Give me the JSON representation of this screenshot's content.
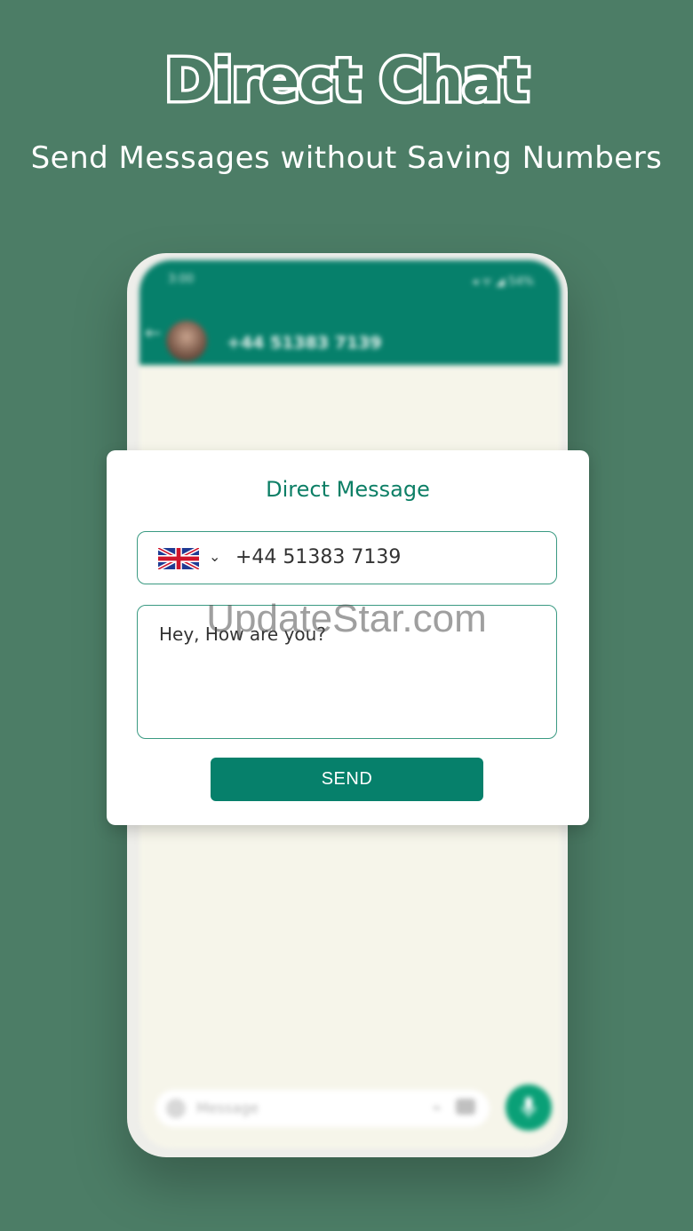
{
  "header": {
    "title": "Direct Chat",
    "subtitle": "Send Messages without Saving Numbers"
  },
  "phone_background": {
    "status_time": "3:00",
    "status_icons": "◂ ᯤ ◢ 54%",
    "contact_number": "+44 51383 7139",
    "composer_placeholder": "Message",
    "mic_icon": "microphone-icon"
  },
  "dialog": {
    "title": "Direct Message",
    "country_flag": "uk-flag-icon",
    "phone_number": "+44 51383 7139",
    "message": "Hey, How are you?",
    "send_label": "SEND"
  },
  "watermark": "UpdateStar.com",
  "colors": {
    "background": "#4c7d66",
    "accent": "#06806b",
    "dialog_title": "#0d7f66"
  }
}
